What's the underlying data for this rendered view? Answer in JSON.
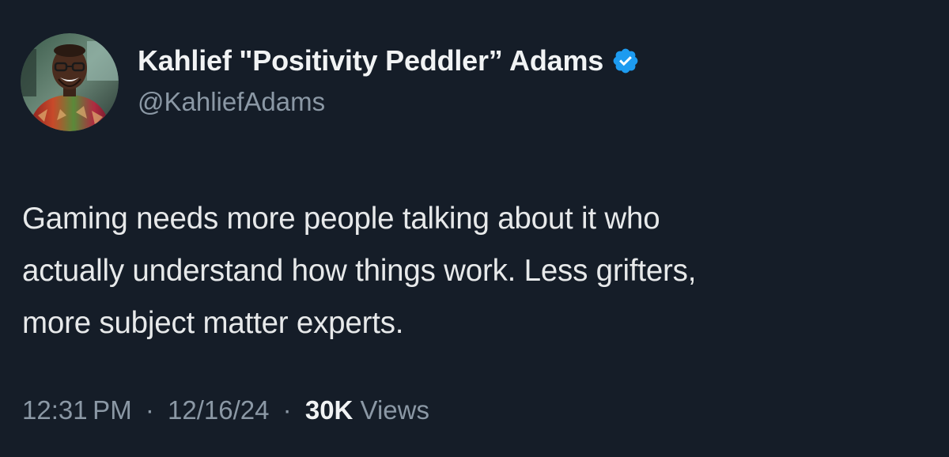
{
  "author": {
    "display_name": "Kahlief \"Positivity Peddler” Adams",
    "handle": "@KahliefAdams",
    "verified": true,
    "avatar_icon": "profile-photo",
    "verified_icon": "verified-badge-icon",
    "verified_color": "#1d9bf0"
  },
  "tweet": {
    "text_lines": [
      "Gaming needs more people talking about it who",
      "actually understand how things work. Less grifters,",
      "more subject matter experts."
    ]
  },
  "meta": {
    "time": "12:31 PM",
    "separator": "·",
    "date": "12/16/24",
    "views_count": "30K",
    "views_label": " Views"
  },
  "theme": {
    "background": "#151d28",
    "text": "#e7e9ea",
    "secondary": "#8b98a5"
  }
}
